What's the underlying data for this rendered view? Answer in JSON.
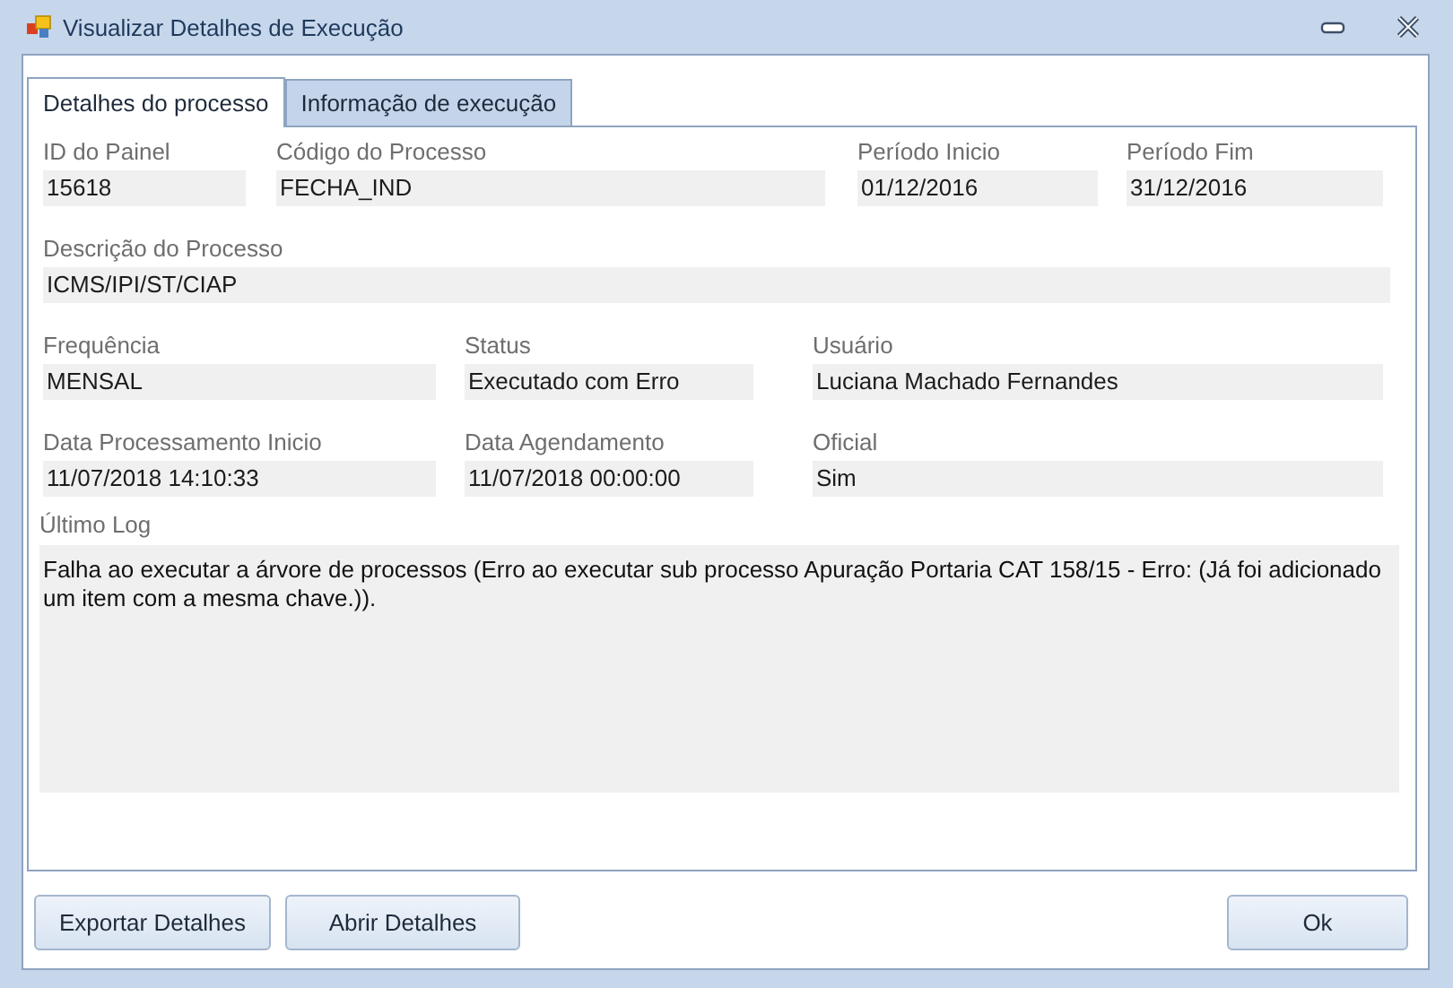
{
  "window": {
    "title": "Visualizar Detalhes de Execução"
  },
  "tabs": [
    {
      "label": "Detalhes do processo",
      "selected": true
    },
    {
      "label": "Informação de execução",
      "selected": false
    }
  ],
  "field_rows": [
    [
      {
        "label": "ID do Painel",
        "value": "15618"
      },
      {
        "label": "Código do Processo",
        "value": "FECHA_IND"
      },
      {
        "label": "Período Inicio",
        "value": "01/12/2016"
      },
      {
        "label": "Período Fim",
        "value": "31/12/2016"
      }
    ],
    [
      {
        "label": "Descrição do Processo",
        "value": "ICMS/IPI/ST/CIAP"
      }
    ],
    [
      {
        "label": "Frequência",
        "value": "MENSAL"
      },
      {
        "label": "Status",
        "value": "Executado com Erro"
      },
      {
        "label": "Usuário",
        "value": "Luciana Machado Fernandes"
      }
    ],
    [
      {
        "label": "Data Processamento Inicio",
        "value": "11/07/2018 14:10:33"
      },
      {
        "label": "Data Agendamento",
        "value": "11/07/2018 00:00:00"
      },
      {
        "label": "Oficial",
        "value": "Sim"
      }
    ]
  ],
  "log": {
    "label": "Último Log",
    "value": "Falha ao executar a árvore de processos (Erro ao executar sub processo Apuração Portaria CAT 158/15 - Erro: (Já foi adicionado um item com a mesma chave.))."
  },
  "footer": {
    "left_buttons": [
      "Exportar Detalhes",
      "Abrir Detalhes"
    ],
    "right_buttons": [
      "Ok"
    ]
  }
}
